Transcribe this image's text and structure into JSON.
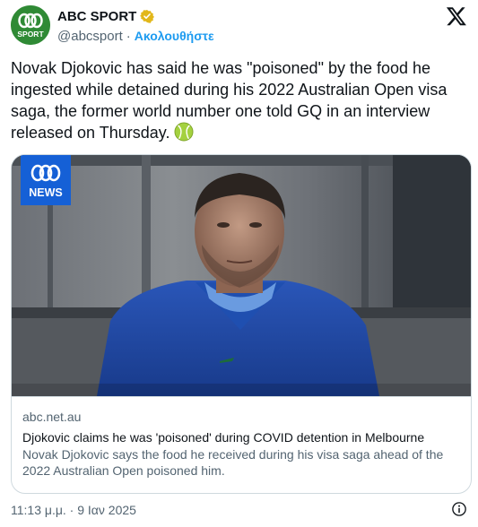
{
  "account": {
    "display_name": "ABC SPORT",
    "handle": "@abcsport",
    "separator": "·",
    "follow_label": "Ακολουθήστε",
    "avatar_text": "SPORT"
  },
  "tweet": {
    "text": "Novak Djokovic has said he was \"poisoned\" by the food he ingested while detained during his 2022 Australian Open visa saga, the former world number one told GQ in an interview released on Thursday.",
    "emoji": "tennis-ball-icon"
  },
  "card": {
    "logo_text": "NEWS",
    "domain": "abc.net.au",
    "title": "Djokovic claims he was 'poisoned' during COVID detention in Melbourne",
    "description": "Novak Djokovic says the food he received during his visa saga ahead of the 2022 Australian Open poisoned him."
  },
  "timestamp": "11:13 μ.μ. · 9 Ιαν 2025",
  "icons": {
    "verified": "verified-badge-icon",
    "platform": "x-logo-icon",
    "info": "info-icon"
  },
  "colors": {
    "accent": "#1d9bf0",
    "avatar_bg": "#2f8a35",
    "abc_news_blue": "#1560d6",
    "verified_gold": "#e2b719"
  }
}
